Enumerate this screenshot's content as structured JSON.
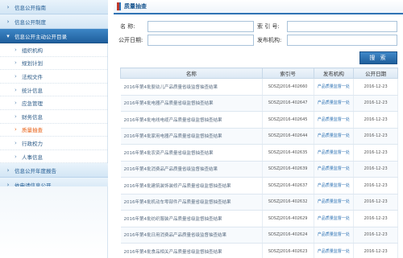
{
  "sidebar": {
    "top_items": [
      {
        "label": "信息公开指南",
        "arrow": "›"
      },
      {
        "label": "信息公开制度",
        "arrow": "›"
      }
    ],
    "active_section": {
      "label": "信息公开主动公开目录",
      "arrow": "▾"
    },
    "sub_items": [
      {
        "label": "组织机构"
      },
      {
        "label": "规划计划"
      },
      {
        "label": "法规文件"
      },
      {
        "label": "统计信息"
      },
      {
        "label": "应急管理"
      },
      {
        "label": "财务信息"
      },
      {
        "label": "质量抽查"
      },
      {
        "label": "行政权力"
      },
      {
        "label": "人事信息"
      }
    ],
    "bottom_items": [
      {
        "label": "信息公开年度报告",
        "arrow": "›"
      },
      {
        "label": "依申请信息公开",
        "arrow": "›"
      }
    ]
  },
  "main": {
    "title": "质量抽查",
    "search": {
      "name_label": "名    称:",
      "index_label": "索 引 号:",
      "date_label": "公开日期:",
      "org_label": "发布机构:",
      "name_value": "",
      "index_value": "",
      "date_value": "",
      "org_value": "",
      "button_label": "搜 索"
    },
    "table": {
      "headers": [
        "名称",
        "索引号",
        "发布机构",
        "公开日期"
      ],
      "rows": [
        {
          "name": "2016年第4批婴幼儿产品质量省级监督抽查结果",
          "index": "SDSZJ2016-402660",
          "org": "产品质量监督一处",
          "date": "2016-12-23"
        },
        {
          "name": "2016年第4批电器产品质量省级监督抽查结果",
          "index": "SDSZJ2016-402647",
          "org": "产品质量监督一处",
          "date": "2016-12-23"
        },
        {
          "name": "2016年第4批电线电缆产品质量省级监督抽查结果",
          "index": "SDSZJ2016-402645",
          "org": "产品质量监督一处",
          "date": "2016-12-23"
        },
        {
          "name": "2016年第4批家用电器产品质量省级监督抽查结果",
          "index": "SDSZJ2016-402644",
          "org": "产品质量监督一处",
          "date": "2016-12-23"
        },
        {
          "name": "2016年第4批农资产品质量省级监督抽查结果",
          "index": "SDSZJ2016-402635",
          "org": "产品质量监督一处",
          "date": "2016-12-23"
        },
        {
          "name": "2016年第4批消费品产品质量省级监督抽查结果",
          "index": "SDSZJ2016-402639",
          "org": "产品质量监督一处",
          "date": "2016-12-23"
        },
        {
          "name": "2016年第4批建筑装饰装修产品质量省级监督抽查结果",
          "index": "SDSZJ2016-402637",
          "org": "产品质量监督一处",
          "date": "2016-12-23"
        },
        {
          "name": "2016年第4批机动车零部件产品质量省级监督抽查结果",
          "index": "SDSZJ2016-402632",
          "org": "产品质量监督一处",
          "date": "2016-12-23"
        },
        {
          "name": "2016年第4批纺织服装产品质量省级监督抽查结果",
          "index": "SDSZJ2016-402629",
          "org": "产品质量监督一处",
          "date": "2016-12-23"
        },
        {
          "name": "2016年第4批日用消费品产品质量省级监督抽查结果",
          "index": "SDSZJ2016-402624",
          "org": "产品质量监督一处",
          "date": "2016-12-23"
        },
        {
          "name": "2016年第4批食品相关产品质量省级监督抽查结果",
          "index": "SDSZJ2016-402623",
          "org": "产品质量监督一处",
          "date": "2016-12-23"
        }
      ]
    }
  }
}
